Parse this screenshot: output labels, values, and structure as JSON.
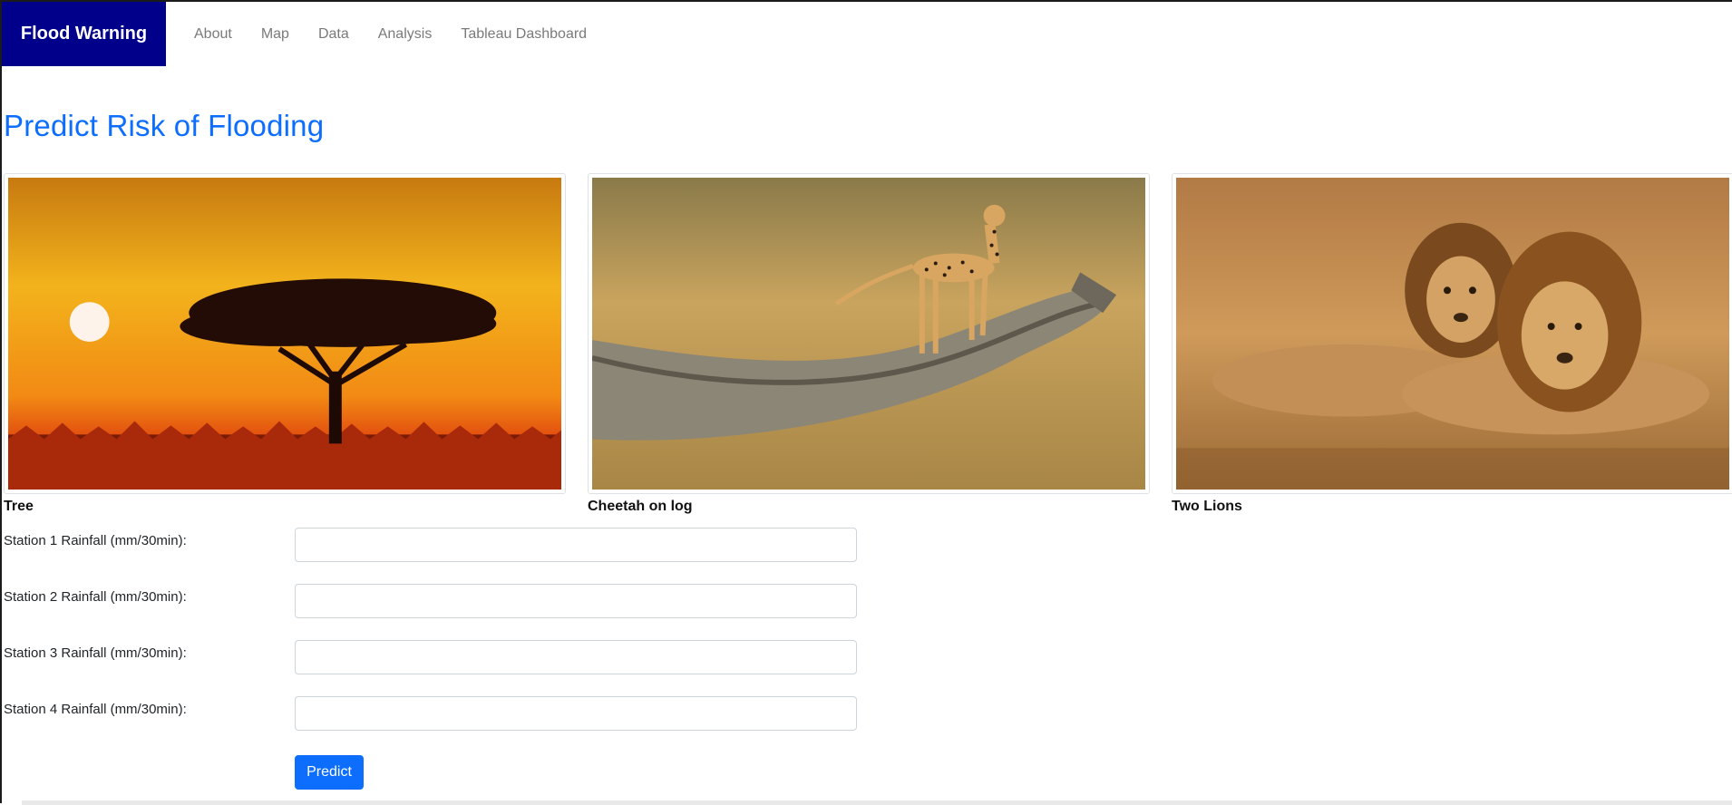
{
  "navbar": {
    "brand": "Flood Warning",
    "links": [
      "About",
      "Map",
      "Data",
      "Analysis",
      "Tableau Dashboard"
    ]
  },
  "page": {
    "title": "Predict Risk of Flooding"
  },
  "gallery": [
    {
      "caption": "Tree",
      "image": "acacia-tree-sunset"
    },
    {
      "caption": "Cheetah on log",
      "image": "cheetah-on-log"
    },
    {
      "caption": "Two Lions",
      "image": "two-lions"
    }
  ],
  "form": {
    "fields": [
      {
        "label": "Station 1 Rainfall (mm/30min):",
        "value": ""
      },
      {
        "label": "Station 2 Rainfall (mm/30min):",
        "value": ""
      },
      {
        "label": "Station 3 Rainfall (mm/30min):",
        "value": ""
      },
      {
        "label": "Station 4 Rainfall (mm/30min):",
        "value": ""
      }
    ],
    "submit_label": "Predict"
  },
  "colors": {
    "brand_bg": "#00008b",
    "title": "#0d6efd",
    "button": "#0d6efd"
  }
}
